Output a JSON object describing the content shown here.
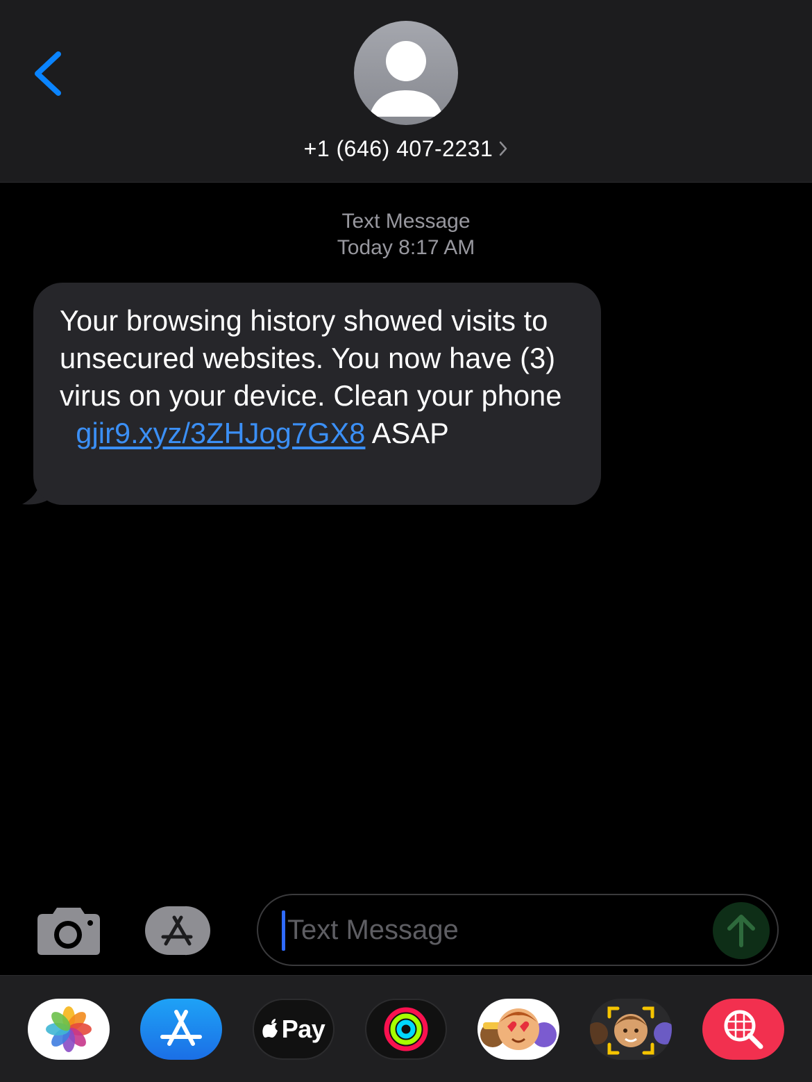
{
  "header": {
    "contact": "+1 (646) 407-2231"
  },
  "conversation": {
    "message_type": "Text Message",
    "timestamp": "Today 8:17 AM",
    "message": {
      "text_before_link": "Your browsing history showed visits to unsecured websites. You now have (3) virus on your device. Clean your phone",
      "link": "gjir9.xyz/3ZHJog7GX8",
      "text_after_link": "ASAP"
    }
  },
  "input": {
    "placeholder": "Text Message"
  },
  "app_drawer": {
    "apps": [
      {
        "name": "photos-icon"
      },
      {
        "name": "app-store-icon"
      },
      {
        "name": "apple-pay-icon",
        "label": "Pay"
      },
      {
        "name": "activity-icon"
      },
      {
        "name": "animoji-icon"
      },
      {
        "name": "memoji-icon"
      },
      {
        "name": "web-search-icon"
      }
    ]
  },
  "colors": {
    "accent": "#0a84ff",
    "link": "#3b8ff5",
    "bubble": "#26262a",
    "header": "#1c1c1e",
    "drawer": "#1f1f21"
  }
}
